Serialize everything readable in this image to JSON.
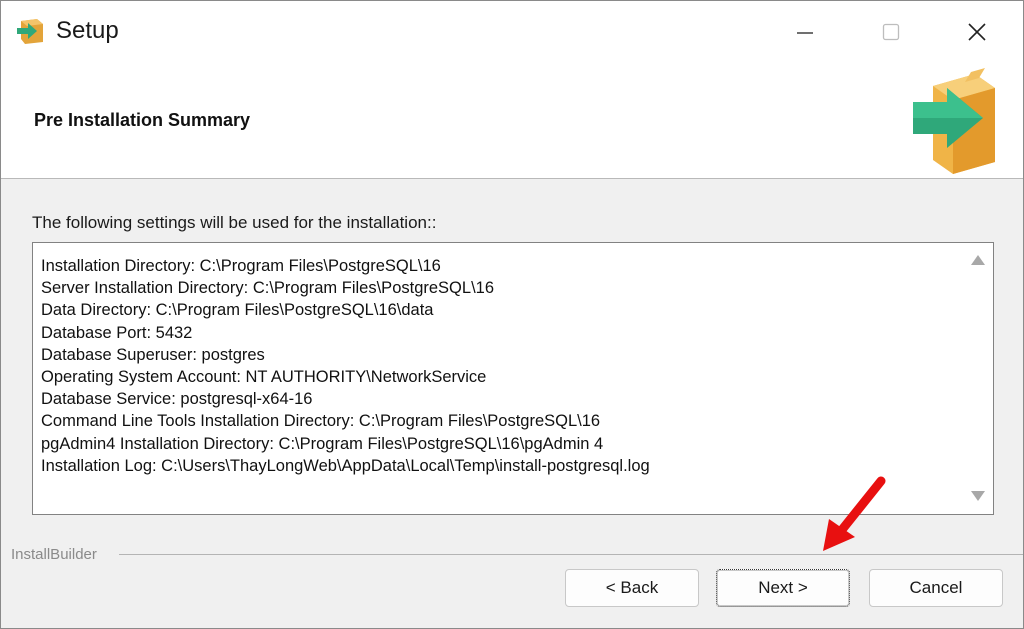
{
  "window": {
    "title": "Setup",
    "controls": {
      "minimize": "minimize-icon",
      "maximize": "maximize-icon",
      "close": "close-icon"
    }
  },
  "header": {
    "title": "Pre Installation Summary",
    "icon": "package-arrow-icon"
  },
  "body": {
    "intro": "The following settings will be used for the installation::",
    "summary_lines": [
      "Installation Directory: C:\\Program Files\\PostgreSQL\\16",
      "Server Installation Directory: C:\\Program Files\\PostgreSQL\\16",
      "Data Directory: C:\\Program Files\\PostgreSQL\\16\\data",
      "Database Port: 5432",
      "Database Superuser: postgres",
      "Operating System Account: NT AUTHORITY\\NetworkService",
      "Database Service: postgresql-x64-16",
      "Command Line Tools Installation Directory: C:\\Program Files\\PostgreSQL\\16",
      "pgAdmin4 Installation Directory: C:\\Program Files\\PostgreSQL\\16\\pgAdmin 4",
      "Installation Log: C:\\Users\\ThayLongWeb\\AppData\\Local\\Temp\\install-postgresql.log"
    ]
  },
  "footer": {
    "brand": "InstallBuilder",
    "back_label": "< Back",
    "next_label": "Next >",
    "cancel_label": "Cancel"
  },
  "colors": {
    "arrow_green": "#2fa87a",
    "box_orange": "#f0b447",
    "annotation_red": "#e81010"
  }
}
